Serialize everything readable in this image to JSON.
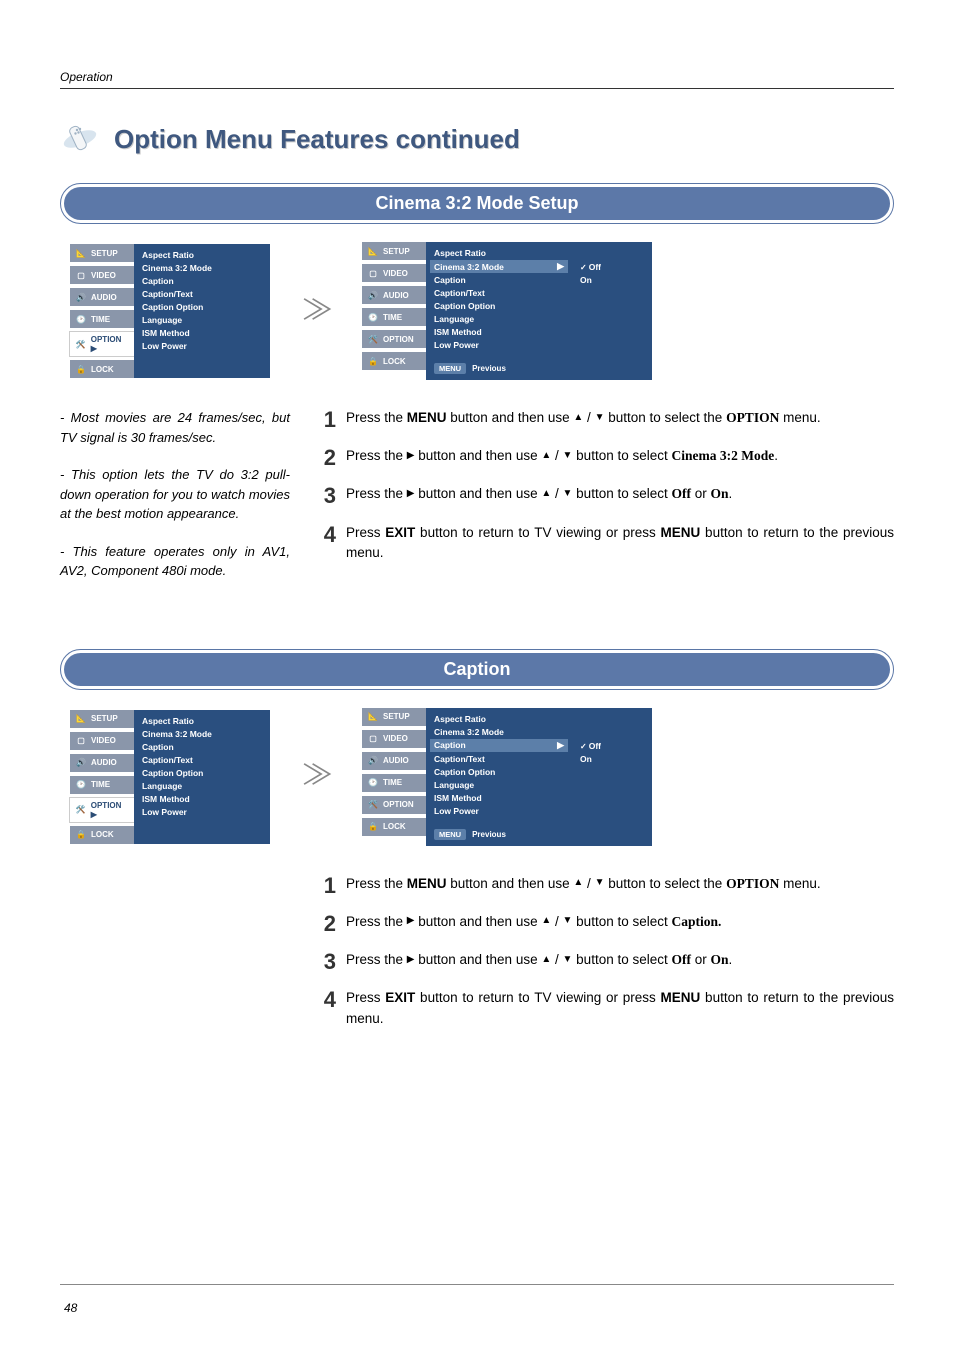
{
  "header": {
    "section": "Operation"
  },
  "title": "Option Menu Features continued",
  "sections": {
    "cinema": {
      "bar": "Cinema 3:2 Mode Setup",
      "osd_tabs": [
        "SETUP",
        "VIDEO",
        "AUDIO",
        "TIME",
        "OPTION",
        "LOCK"
      ],
      "osd_option_arrow": "▶",
      "osd_items": [
        "Aspect Ratio",
        "Cinema 3:2 Mode",
        "Caption",
        "Caption/Text",
        "Caption Option",
        "Language",
        "ISM Method",
        "Low Power"
      ],
      "osd_highlight": "Cinema 3:2 Mode",
      "osd_values": [
        "Off",
        "On"
      ],
      "osd_footer_menu": "MENU",
      "osd_footer_prev": "Previous",
      "notes": [
        "- Most movies are 24 frames/sec, but TV signal is 30 frames/sec.",
        "- This option lets the TV do 3:2 pull-down operation for you to watch movies at the best motion appearance.",
        "- This feature operates only in AV1, AV2, Component 480i mode."
      ],
      "steps": {
        "s1a": "Press the ",
        "s1b": "MENU",
        "s1c": " button and then use ",
        "s1d": " button to select the ",
        "s1e": "OPTION",
        "s1f": " menu.",
        "s2a": "Press the ",
        "s2b": " button and then use ",
        "s2c": " button to select ",
        "s2d": "Cinema 3:2 Mode",
        "s2e": ".",
        "s3a": "Press the ",
        "s3b": " button and then use ",
        "s3c": " button to select ",
        "s3d": "Off",
        "s3e": " or ",
        "s3f": "On",
        "s3g": ".",
        "s4a": "Press ",
        "s4b": "EXIT",
        "s4c": " button to return to TV viewing or press ",
        "s4d": "MENU",
        "s4e": " button to return to the previous menu."
      }
    },
    "caption": {
      "bar": "Caption",
      "osd_highlight": "Caption",
      "osd_values": [
        "Off",
        "On"
      ],
      "steps": {
        "s1a": "Press the ",
        "s1b": "MENU",
        "s1c": " button and then use ",
        "s1d": " button to select the ",
        "s1e": "OPTION",
        "s1f": " menu.",
        "s2a": "Press the ",
        "s2b": " button and then use ",
        "s2c": " button to select ",
        "s2d": "Caption.",
        "s3a": "Press the ",
        "s3b": " button and then use ",
        "s3c": " button to select ",
        "s3d": "Off",
        "s3e": " or ",
        "s3f": "On",
        "s3g": ".",
        "s4a": "Press ",
        "s4b": "EXIT",
        "s4c": " button to return to TV viewing or press ",
        "s4d": "MENU",
        "s4e": " button to return to the previous menu."
      }
    }
  },
  "footer": {
    "page": "48"
  },
  "icons": {
    "up": "▲",
    "down": "▼",
    "right": "▶",
    "slash": " / "
  }
}
